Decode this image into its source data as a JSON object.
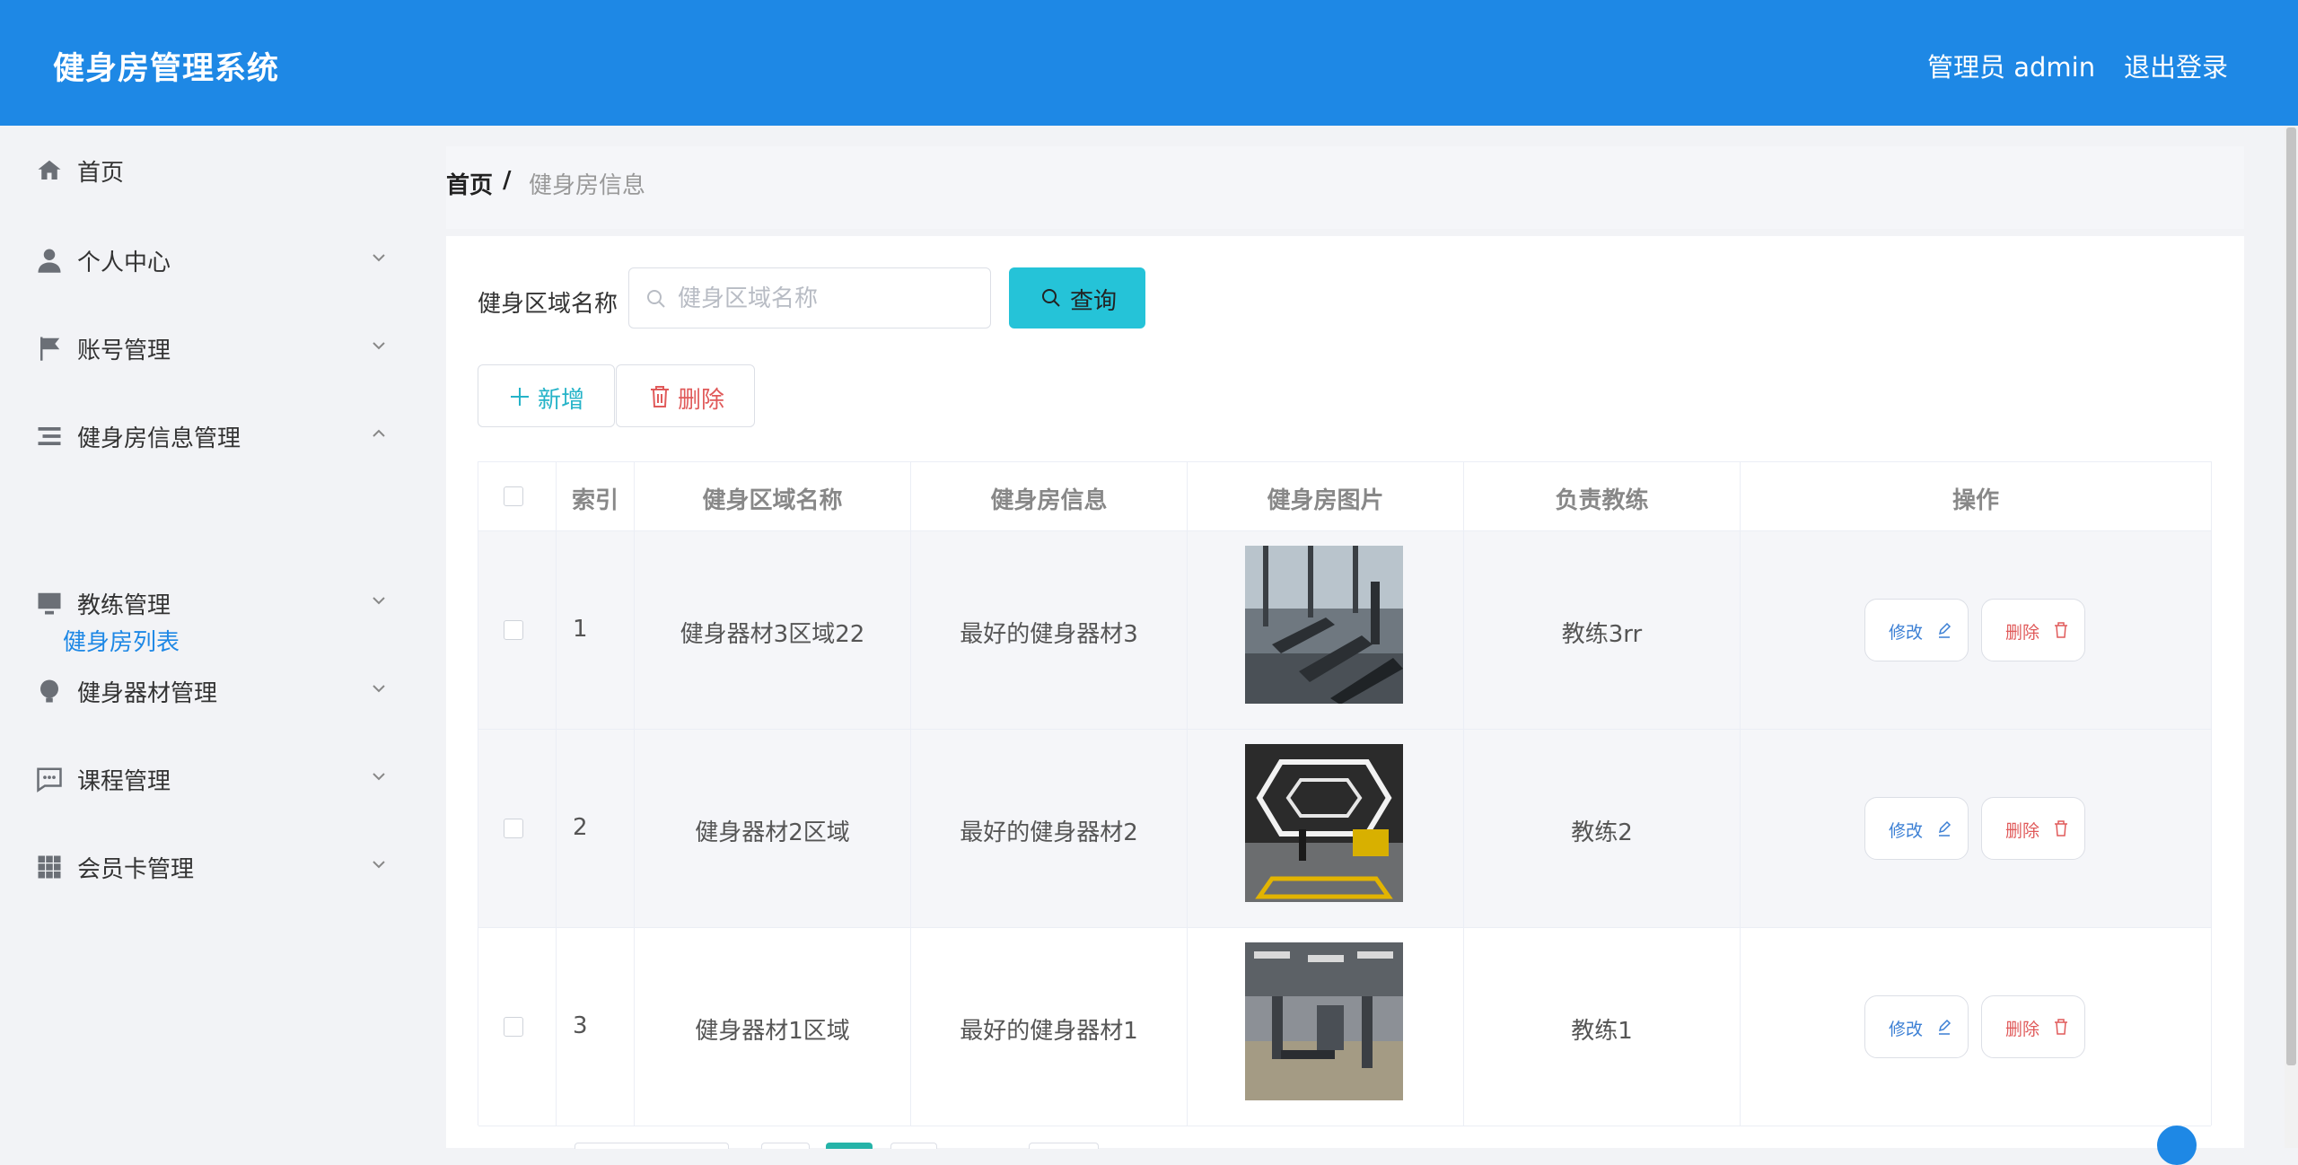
{
  "header": {
    "app_title": "健身房管理系统",
    "user_label": "管理员 admin",
    "logout_label": "退出登录"
  },
  "sidebar": {
    "items": [
      {
        "label": "首页",
        "icon": "home-icon"
      },
      {
        "label": "个人中心",
        "icon": "user-icon"
      },
      {
        "label": "账号管理",
        "icon": "flag-icon"
      },
      {
        "label": "健身房信息管理",
        "icon": "list-icon"
      },
      {
        "label": "教练管理",
        "icon": "monitor-icon"
      },
      {
        "label": "健身器材管理",
        "icon": "bulb-icon"
      },
      {
        "label": "课程管理",
        "icon": "chat-icon"
      },
      {
        "label": "会员卡管理",
        "icon": "grid-icon"
      }
    ],
    "submenu_label": "健身房列表"
  },
  "breadcrumb": {
    "home": "首页",
    "separator": "/",
    "current": "健身房信息"
  },
  "search": {
    "label": "健身区域名称",
    "placeholder": "健身区域名称",
    "value": "",
    "query_label": "查询"
  },
  "toolbar": {
    "add_label": "新增",
    "delete_label": "删除"
  },
  "table": {
    "columns": [
      "索引",
      "健身区域名称",
      "健身房信息",
      "健身房图片",
      "负责教练",
      "操作"
    ],
    "rows": [
      {
        "index": "1",
        "area_name": "健身器材3区域22",
        "info": "最好的健身器材3",
        "coach": "教练3rr"
      },
      {
        "index": "2",
        "area_name": "健身器材2区域",
        "info": "最好的健身器材2",
        "coach": "教练2"
      },
      {
        "index": "3",
        "area_name": "健身器材1区域",
        "info": "最好的健身器材1",
        "coach": "教练1"
      }
    ],
    "edit_label": "修改",
    "delete_label": "删除"
  },
  "colors": {
    "header_bg": "#1e88e5",
    "query_button": "#25c3d8",
    "danger": "#e05a5a",
    "link": "#1e88e5"
  }
}
